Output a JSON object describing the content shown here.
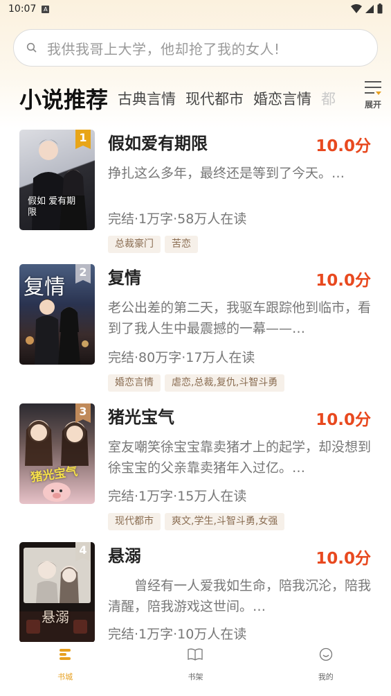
{
  "status_bar": {
    "time": "10:07",
    "notif_icon": "a-icon"
  },
  "search": {
    "placeholder": "我供我哥上大学，他却抢了我的女人!"
  },
  "tabs": {
    "active": "小说推荐",
    "items": [
      "古典言情",
      "现代都市",
      "婚恋言情",
      "都"
    ]
  },
  "expand": {
    "label": "展开"
  },
  "books": [
    {
      "rank": "1",
      "title": "假如爱有期限",
      "score": "10.0分",
      "desc": "挣扎这么多年，最终还是等到了今天。…",
      "meta": "完结·1万字·58万人在读",
      "tags": [
        "总裁豪门",
        "苦恋"
      ],
      "cover_text": "假如 爱有期限"
    },
    {
      "rank": "2",
      "title": "复情",
      "score": "10.0分",
      "desc": "老公出差的第二天，我驱车跟踪他到临市，看到了我人生中最震撼的一幕——…",
      "meta": "完结·80万字·17万人在读",
      "tags": [
        "婚恋言情",
        "虐恋,总裁,复仇,斗智斗勇"
      ],
      "cover_text": "复情"
    },
    {
      "rank": "3",
      "title": "猪光宝气",
      "score": "10.0分",
      "desc": "室友嘲笑徐宝宝靠卖猪才上的起学，却没想到徐宝宝的父亲靠卖猪年入过亿。…",
      "meta": "完结·1万字·15万人在读",
      "tags": [
        "现代都市",
        "爽文,学生,斗智斗勇,女强"
      ],
      "cover_text": "猪光宝气"
    },
    {
      "rank": "4",
      "title": "悬溺",
      "score": "10.0分",
      "desc": "　　曾经有一人爱我如生命，陪我沉沦，陪我清醒，陪我游戏这世间。…",
      "meta": "完结·1万字·10万人在读",
      "tags": [],
      "cover_text": "悬溺"
    }
  ],
  "nav": [
    {
      "label": "书城",
      "icon": "bookstore-icon",
      "active": true
    },
    {
      "label": "书架",
      "icon": "bookshelf-icon",
      "active": false
    },
    {
      "label": "我的",
      "icon": "profile-icon",
      "active": false
    }
  ],
  "colors": {
    "accent": "#e7a020",
    "score": "#e8491f"
  }
}
